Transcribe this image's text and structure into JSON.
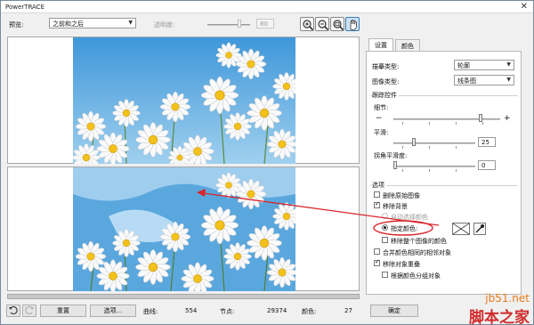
{
  "window": {
    "title": "PowerTRACE",
    "close_glyph": "✕"
  },
  "top": {
    "preview_label": "预览:",
    "preview_value": "之前和之后",
    "transparency_label": "透明度:",
    "transparency_value": "80"
  },
  "zoom_icons": [
    "zoom-in-icon",
    "zoom-out-icon",
    "zoom-fit-icon",
    "pan-hand-icon"
  ],
  "tabs": [
    {
      "label": "设置"
    },
    {
      "label": "颜色"
    }
  ],
  "settings": {
    "trace_type_label": "描摹类型:",
    "trace_type_value": "轮廓",
    "image_type_label": "图像类型:",
    "image_type_value": "线条图",
    "trace_controls_title": "跟踪控件",
    "detail_label": "细节:",
    "minus": "−",
    "plus": "+",
    "smoothing_label": "平滑:",
    "smoothing_value": "25",
    "corner_label": "拐角平滑度:",
    "corner_value": "0",
    "options_title": "选项",
    "opt_delete_original": "删除原始图像",
    "opt_remove_background": "移除背景",
    "opt_auto_color": "自动选择颜色",
    "opt_specify_color": "指定颜色:",
    "opt_remove_whole_bg": "移除整个图像的颜色",
    "opt_merge_adjacent": "合并颜色相同的相邻对象",
    "opt_remove_overlap": "移除对象重叠",
    "opt_group_by_color": "根据颜色分组对象"
  },
  "bottom": {
    "reset_label": "重置",
    "options_label": "选项...",
    "curves_label": "曲线:",
    "curves_value": "554",
    "nodes_label": "节点:",
    "nodes_value": "29374",
    "colors_label": "颜色:",
    "colors_value": "27",
    "ok_label": "确定",
    "undo_icon": "undo-icon",
    "redo_icon": "redo-icon"
  },
  "watermark": {
    "line1": "jb51.net",
    "line2": "脚本之家"
  },
  "colors": {
    "sky": "#5aa7de",
    "annotation_red": "#d8252a",
    "accent_blue": "#3c7fb1"
  }
}
